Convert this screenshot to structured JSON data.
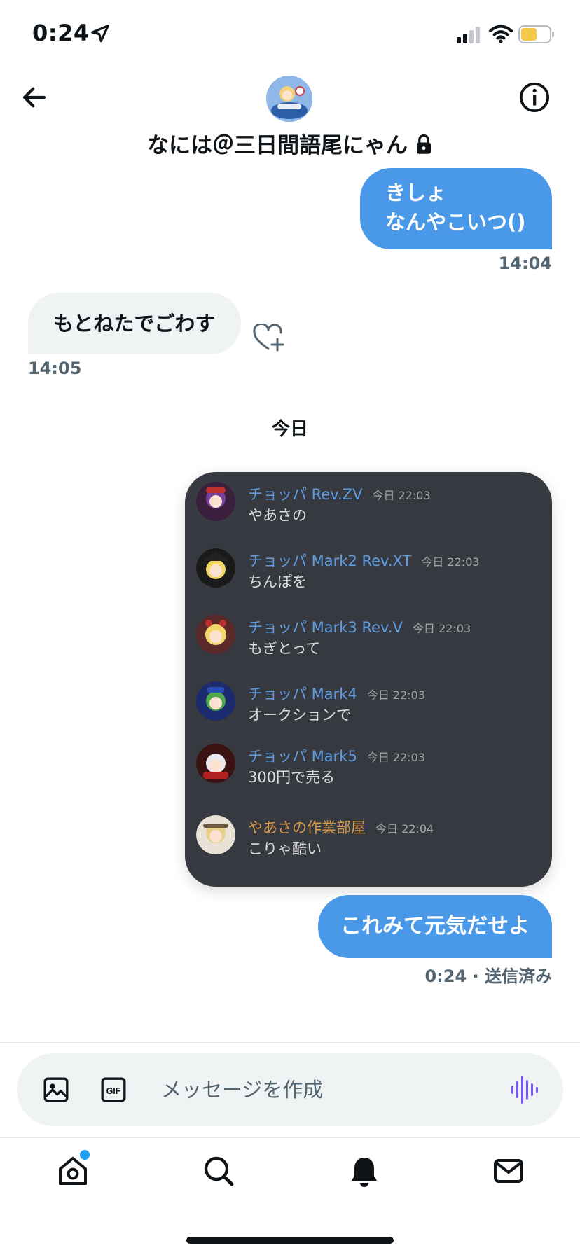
{
  "status_bar": {
    "time": "0:24",
    "icons": [
      "location-arrow-icon",
      "signal-icon",
      "wifi-icon",
      "battery-icon"
    ],
    "battery_color": "#f4c94a"
  },
  "header": {
    "title": "なには＠三日間語尾にゃん",
    "icons": [
      "back-arrow-icon",
      "info-icon",
      "lock-icon"
    ]
  },
  "messages": [
    {
      "direction": "outgoing",
      "lines": [
        "きしょ",
        "なんやこいつ()"
      ],
      "time": "14:04"
    },
    {
      "direction": "incoming",
      "text": "もとねたでごわす",
      "time": "14:05"
    }
  ],
  "day_divider": "今日",
  "image_card": {
    "rows": [
      {
        "name": "チョッパ Rev.ZV",
        "stamp": "今日 22:03",
        "text": "やあさの"
      },
      {
        "name": "チョッパ Mark2 Rev.XT",
        "stamp": "今日 22:03",
        "text": "ちんぽを"
      },
      {
        "name": "チョッパ Mark3 Rev.V",
        "stamp": "今日 22:03",
        "text": "もぎとって"
      },
      {
        "name": "チョッパ Mark4",
        "stamp": "今日 22:03",
        "text": "オークションで"
      },
      {
        "name": "チョッパ Mark5",
        "stamp": "今日 22:03",
        "text": "300円で売る"
      },
      {
        "name": "やあさの作業部屋",
        "stamp": "今日 22:04",
        "text": "こりゃ酷い"
      }
    ],
    "name_color": "#5f9de2",
    "owner_name_color": "#d89a4b",
    "background": "#36393f"
  },
  "last_message": {
    "text": "これみて元気だせよ",
    "time": "0:24",
    "status": "送信済み"
  },
  "compose": {
    "placeholder": "メッセージを作成",
    "icons": [
      "image-icon",
      "gif-icon",
      "voice-icon"
    ]
  },
  "tab_bar": {
    "items": [
      "home-icon",
      "search-icon",
      "notifications-icon",
      "messages-icon"
    ],
    "notification_dot_color": "#1d9bf0"
  },
  "colors": {
    "accent": "#4a99e9",
    "incoming_bubble": "#eff3f4",
    "voice_accent": "#7856ff"
  }
}
